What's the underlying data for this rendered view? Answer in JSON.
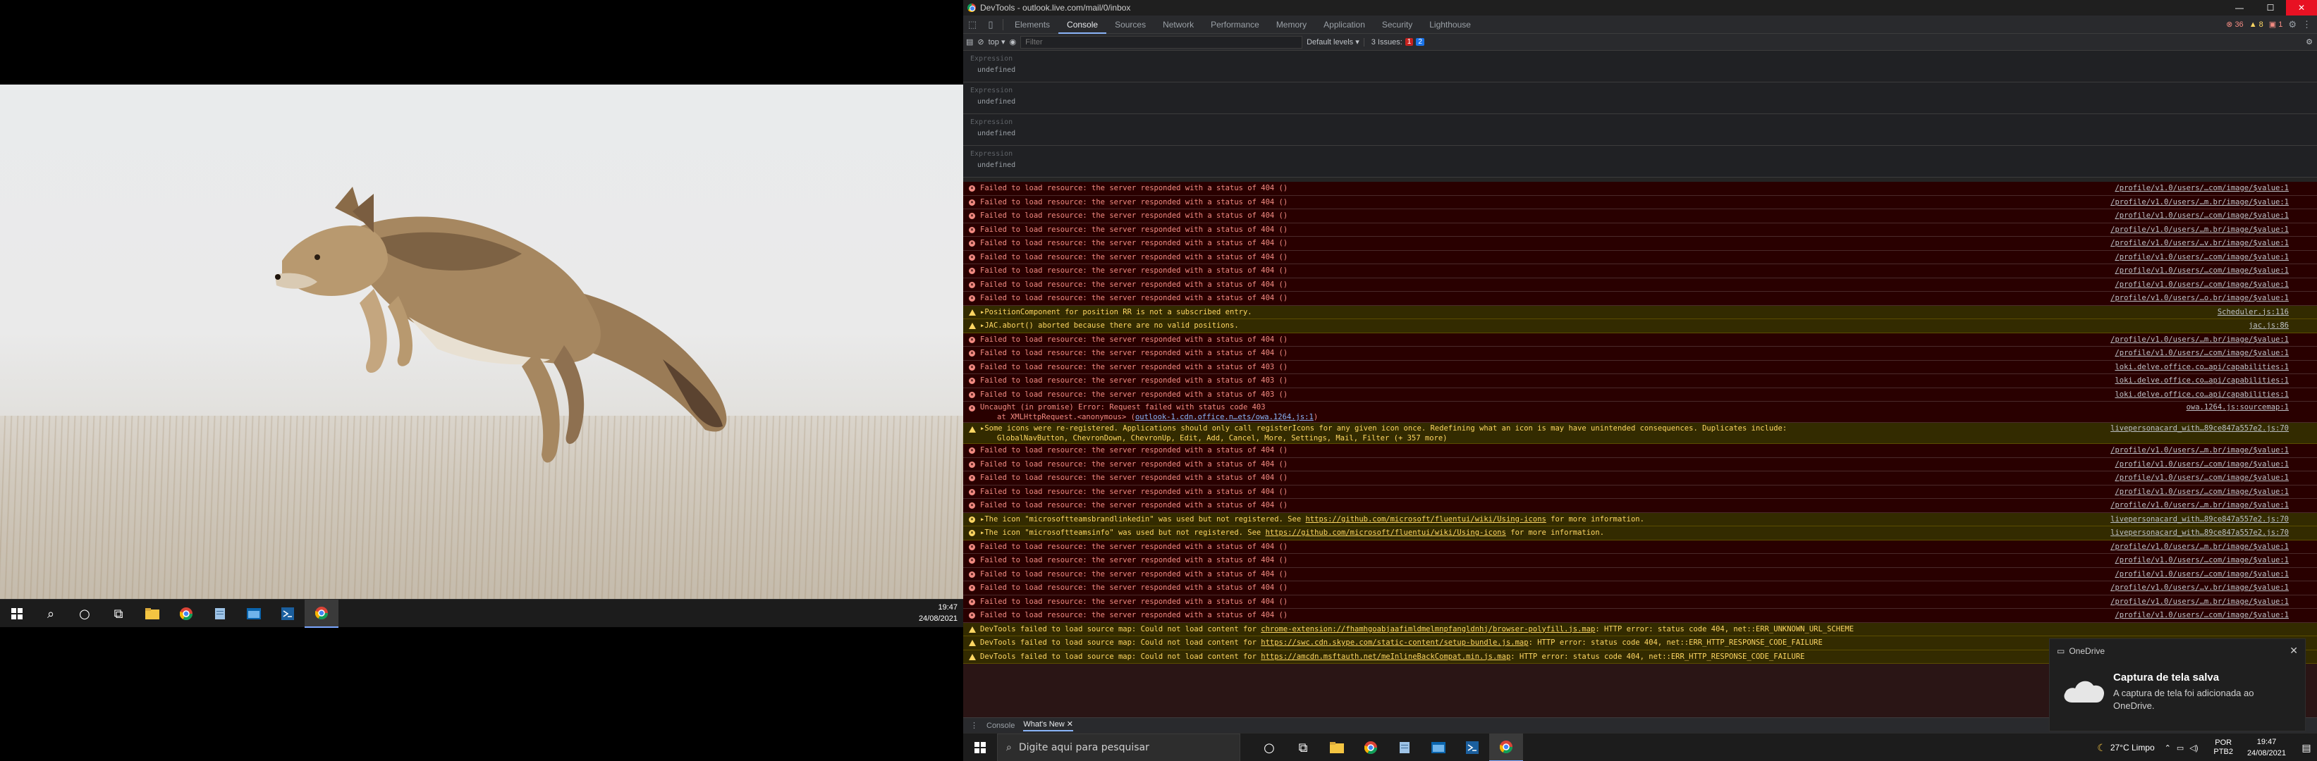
{
  "left_taskbar": {
    "time": "19:47",
    "date": "24/08/2021"
  },
  "devtools": {
    "window_title": "DevTools - outlook.live.com/mail/0/inbox",
    "tabs": [
      "Elements",
      "Console",
      "Sources",
      "Network",
      "Performance",
      "Memory",
      "Application",
      "Security",
      "Lighthouse"
    ],
    "selected_tab": "Console",
    "error_count": "36",
    "warning_count": "8",
    "issue_count_badge": "1",
    "context": "top",
    "filter_placeholder": "Filter",
    "levels": "Default levels",
    "issues_label": "3 Issues:",
    "issues_red": "1",
    "issues_blue": "2",
    "expressions": [
      {
        "label": "Expression",
        "value": "undefined"
      },
      {
        "label": "Expression",
        "value": "undefined"
      },
      {
        "label": "Expression",
        "value": "undefined"
      },
      {
        "label": "Expression",
        "value": "undefined"
      }
    ],
    "rows": [
      {
        "type": "error",
        "msg": "Failed to load resource: the server responded with a status of 404 ()",
        "src": "/profile/v1.0/users/…com/image/$value:1"
      },
      {
        "type": "error",
        "msg": "Failed to load resource: the server responded with a status of 404 ()",
        "src": "/profile/v1.0/users/…m.br/image/$value:1"
      },
      {
        "type": "error",
        "msg": "Failed to load resource: the server responded with a status of 404 ()",
        "src": "/profile/v1.0/users/…com/image/$value:1"
      },
      {
        "type": "error",
        "msg": "Failed to load resource: the server responded with a status of 404 ()",
        "src": "/profile/v1.0/users/…m.br/image/$value:1"
      },
      {
        "type": "error",
        "msg": "Failed to load resource: the server responded with a status of 404 ()",
        "src": "/profile/v1.0/users/…v.br/image/$value:1"
      },
      {
        "type": "error",
        "msg": "Failed to load resource: the server responded with a status of 404 ()",
        "src": "/profile/v1.0/users/…com/image/$value:1"
      },
      {
        "type": "error",
        "msg": "Failed to load resource: the server responded with a status of 404 ()",
        "src": "/profile/v1.0/users/…com/image/$value:1"
      },
      {
        "type": "error",
        "msg": "Failed to load resource: the server responded with a status of 404 ()",
        "src": "/profile/v1.0/users/…com/image/$value:1"
      },
      {
        "type": "error",
        "msg": "Failed to load resource: the server responded with a status of 404 ()",
        "src": "/profile/v1.0/users/…o.br/image/$value:1"
      },
      {
        "type": "warn",
        "msg": "▸PositionComponent for position RR is not a subscribed entry.",
        "src": "Scheduler.js:116"
      },
      {
        "type": "warn",
        "msg": "▸JAC.abort() aborted because there are no valid positions.",
        "src": "jac.js:86"
      },
      {
        "type": "error",
        "msg": "Failed to load resource: the server responded with a status of 404 ()",
        "src": "/profile/v1.0/users/…m.br/image/$value:1"
      },
      {
        "type": "error",
        "msg": "Failed to load resource: the server responded with a status of 404 ()",
        "src": "/profile/v1.0/users/…com/image/$value:1"
      },
      {
        "type": "error",
        "msg": "Failed to load resource: the server responded with a status of 403 ()",
        "src": "loki.delve.office.co…api/capabilities:1"
      },
      {
        "type": "error",
        "msg": "Failed to load resource: the server responded with a status of 403 ()",
        "src": "loki.delve.office.co…api/capabilities:1"
      },
      {
        "type": "error",
        "msg": "Failed to load resource: the server responded with a status of 403 ()",
        "src": "loki.delve.office.co…api/capabilities:1"
      },
      {
        "type": "error",
        "tall": true,
        "msg": "Uncaught (in promise) Error: Request failed with status code 403",
        "sub": "at XMLHttpRequest.<anonymous> (",
        "sub_link": "outlook-1.cdn.office.n…ets/owa.1264.js:1",
        "sub_end": ")",
        "src": "owa.1264.js:sourcemap:1"
      },
      {
        "type": "warn",
        "tall": true,
        "msg": "▸Some icons were re-registered. Applications should only call registerIcons for any given icon once. Redefining what an icon is may have unintended consequences. Duplicates include:",
        "sub": "GlobalNavButton, ChevronDown, ChevronUp, Edit, Add, Cancel, More, Settings, Mail, Filter (+ 357 more)",
        "src": "livepersonacard_with…89ce847a557e2.js:70"
      },
      {
        "type": "error",
        "msg": "Failed to load resource: the server responded with a status of 404 ()",
        "src": "/profile/v1.0/users/…m.br/image/$value:1"
      },
      {
        "type": "error",
        "msg": "Failed to load resource: the server responded with a status of 404 ()",
        "src": "/profile/v1.0/users/…com/image/$value:1"
      },
      {
        "type": "error",
        "msg": "Failed to load resource: the server responded with a status of 404 ()",
        "src": "/profile/v1.0/users/…com/image/$value:1"
      },
      {
        "type": "error",
        "msg": "Failed to load resource: the server responded with a status of 404 ()",
        "src": "/profile/v1.0/users/…com/image/$value:1"
      },
      {
        "type": "error",
        "msg": "Failed to load resource: the server responded with a status of 404 ()",
        "src": "/profile/v1.0/users/…m.br/image/$value:1"
      },
      {
        "type": "err2",
        "msg": "▸The icon \"microsoftteamsbrandlinkedin\" was used but not registered. See ",
        "link": "https://github.com/microsoft/fluentui/wiki/Using-icons",
        "end": " for more information.",
        "src": "livepersonacard_with…89ce847a557e2.js:70"
      },
      {
        "type": "err2",
        "msg": "▸The icon \"microsoftteamsinfo\" was used but not registered. See ",
        "link": "https://github.com/microsoft/fluentui/wiki/Using-icons",
        "end": " for more information.",
        "src": "livepersonacard_with…89ce847a557e2.js:70"
      },
      {
        "type": "error",
        "msg": "Failed to load resource: the server responded with a status of 404 ()",
        "src": "/profile/v1.0/users/…m.br/image/$value:1"
      },
      {
        "type": "error",
        "msg": "Failed to load resource: the server responded with a status of 404 ()",
        "src": "/profile/v1.0/users/…com/image/$value:1"
      },
      {
        "type": "error",
        "msg": "Failed to load resource: the server responded with a status of 404 ()",
        "src": "/profile/v1.0/users/…com/image/$value:1"
      },
      {
        "type": "error",
        "msg": "Failed to load resource: the server responded with a status of 404 ()",
        "src": "/profile/v1.0/users/…v.br/image/$value:1"
      },
      {
        "type": "error",
        "msg": "Failed to load resource: the server responded with a status of 404 ()",
        "src": "/profile/v1.0/users/…m.br/image/$value:1"
      },
      {
        "type": "error",
        "msg": "Failed to load resource: the server responded with a status of 404 ()",
        "src": "/profile/v1.0/users/…com/image/$value:1"
      },
      {
        "type": "warn",
        "msg": "DevTools failed to load source map: Could not load content for ",
        "link": "chrome-extension://fhamhgoabjaafimldmelmnpfangldnhj/browser-polyfill.js.map",
        "end": ": HTTP error: status code 404, net::ERR_UNKNOWN_URL_SCHEME",
        "src": ""
      },
      {
        "type": "warn",
        "msg": "DevTools failed to load source map: Could not load content for ",
        "link": "https://swc.cdn.skype.com/static-content/setup-bundle.js.map",
        "end": ": HTTP error: status code 404, net::ERR_HTTP_RESPONSE_CODE_FAILURE",
        "src": ""
      },
      {
        "type": "warn",
        "msg": "DevTools failed to load source map: Could not load content for ",
        "link": "https://amcdn.msftauth.net/meInlineBackCompat.min.js.map",
        "end": ": HTTP error: status code 404, net::ERR_HTTP_RESPONSE_CODE_FAILURE",
        "src": ""
      }
    ],
    "drawer_tabs": [
      "Console",
      "What's New"
    ]
  },
  "toast": {
    "app": "OneDrive",
    "title": "Captura de tela salva",
    "body": "A captura de tela foi adicionada ao OneDrive."
  },
  "right_taskbar": {
    "search_placeholder": "Digite aqui para pesquisar",
    "weather": "27°C  Limpo",
    "lang_top": "POR",
    "lang_bottom": "PTB2",
    "time": "19:47",
    "date": "24/08/2021"
  }
}
